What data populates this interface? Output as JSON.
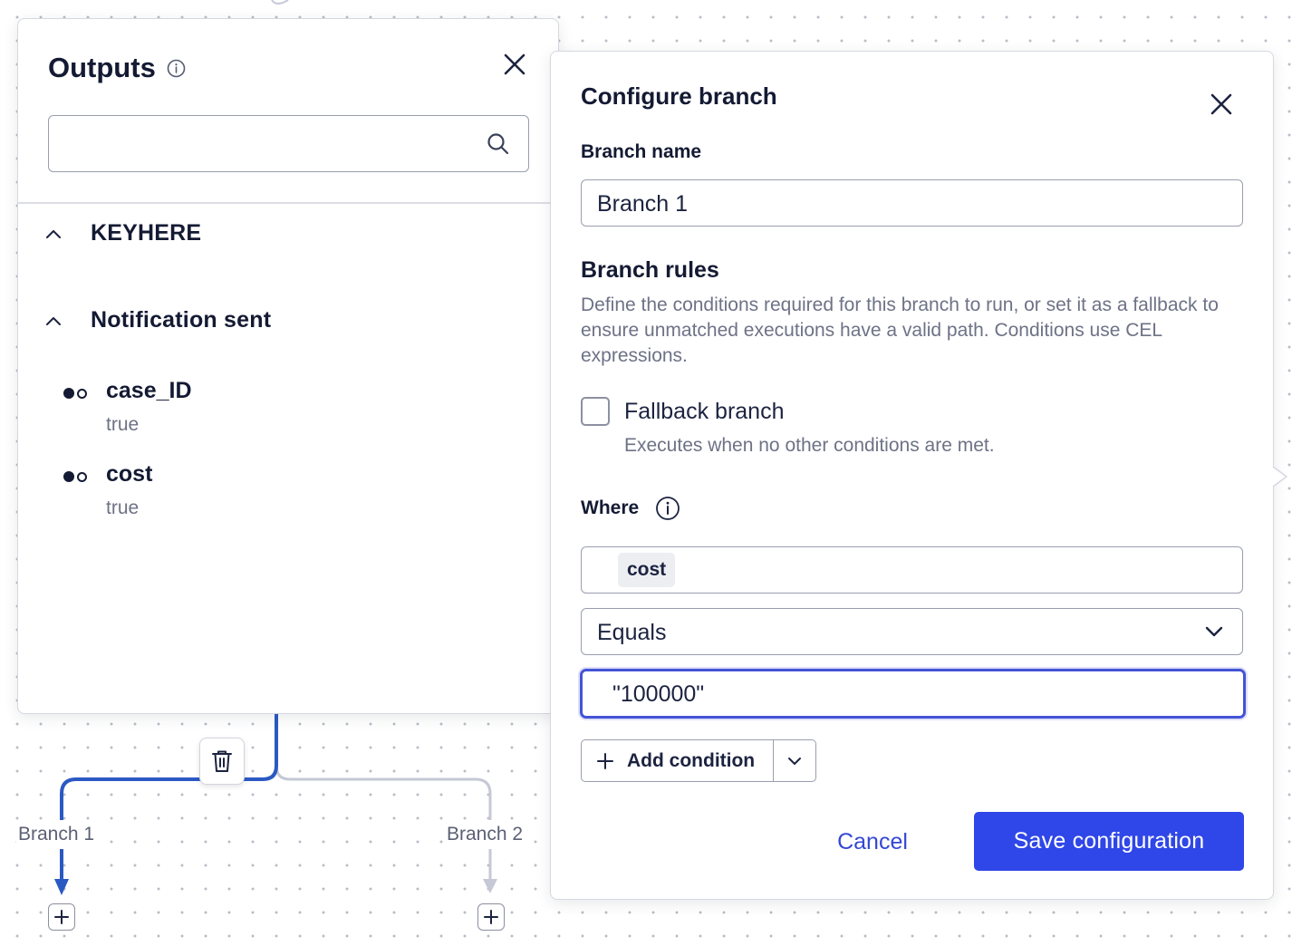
{
  "canvas": {
    "branches": [
      {
        "label": "Branch 1",
        "active": true
      },
      {
        "label": "Branch 2",
        "active": false
      }
    ],
    "icons": {
      "delete": "trash-icon",
      "add": "plus-icon"
    },
    "colors": {
      "active_edge": "#2b59c3",
      "inactive_edge": "#c6c8d6"
    }
  },
  "outputs": {
    "title": "Outputs",
    "search_placeholder": "",
    "groups": [
      {
        "label": "KEYHERE",
        "expanded": true,
        "items": []
      },
      {
        "label": "Notification sent",
        "expanded": true,
        "items": [
          {
            "name": "case_ID",
            "value": "true"
          },
          {
            "name": "cost",
            "value": "true"
          }
        ]
      }
    ]
  },
  "config": {
    "title": "Configure branch",
    "branch_name_label": "Branch name",
    "branch_name_value": "Branch 1",
    "rules_title": "Branch rules",
    "rules_description": "Define the conditions required for this branch to run, or set it as a fallback to ensure unmatched executions have a valid path. Conditions use CEL expressions.",
    "fallback_label": "Fallback branch",
    "fallback_checked": false,
    "fallback_help": "Executes when no other conditions are met.",
    "where_label": "Where",
    "condition": {
      "field": "cost",
      "operator": "Equals",
      "value": "\"100000\""
    },
    "add_condition_label": "Add condition",
    "cancel_label": "Cancel",
    "save_label": "Save configuration",
    "accent_color": "#2f46e8"
  }
}
